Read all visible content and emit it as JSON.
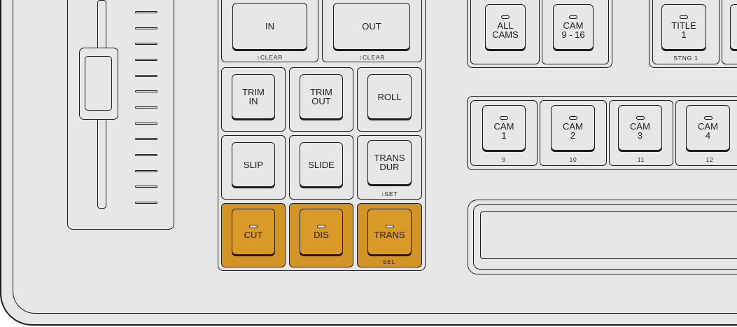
{
  "transition_keys": {
    "in": {
      "label": "IN",
      "sub": "↕CLEAR"
    },
    "out": {
      "label": "OUT",
      "sub": "↕CLEAR"
    },
    "trim_in": {
      "label": "TRIM\nIN"
    },
    "trim_out": {
      "label": "TRIM\nOUT"
    },
    "roll": {
      "label": "ROLL"
    },
    "slip": {
      "label": "SLIP"
    },
    "slide": {
      "label": "SLIDE"
    },
    "trans_dur": {
      "label": "TRANS\nDUR",
      "sub": "↕SET"
    },
    "cut": {
      "label": "CUT"
    },
    "dis": {
      "label": "DIS"
    },
    "trans": {
      "label": "TRANS",
      "sub": "SEL"
    }
  },
  "source_keys": {
    "all_cams": {
      "label": "ALL\nCAMS"
    },
    "cam_9_16": {
      "label": "CAM\n9 - 16"
    },
    "title_1": {
      "label": "TITLE\n1",
      "sub": "STNG 1"
    }
  },
  "cam_keys": [
    {
      "label": "CAM\n1",
      "sub": "9"
    },
    {
      "label": "CAM\n2",
      "sub": "10"
    },
    {
      "label": "CAM\n3",
      "sub": "11"
    },
    {
      "label": "CAM\n4",
      "sub": "12"
    }
  ],
  "colors": {
    "panel": "#e7e7e7",
    "outline": "#1c1c1c",
    "accent_orange": "#d99a28"
  }
}
